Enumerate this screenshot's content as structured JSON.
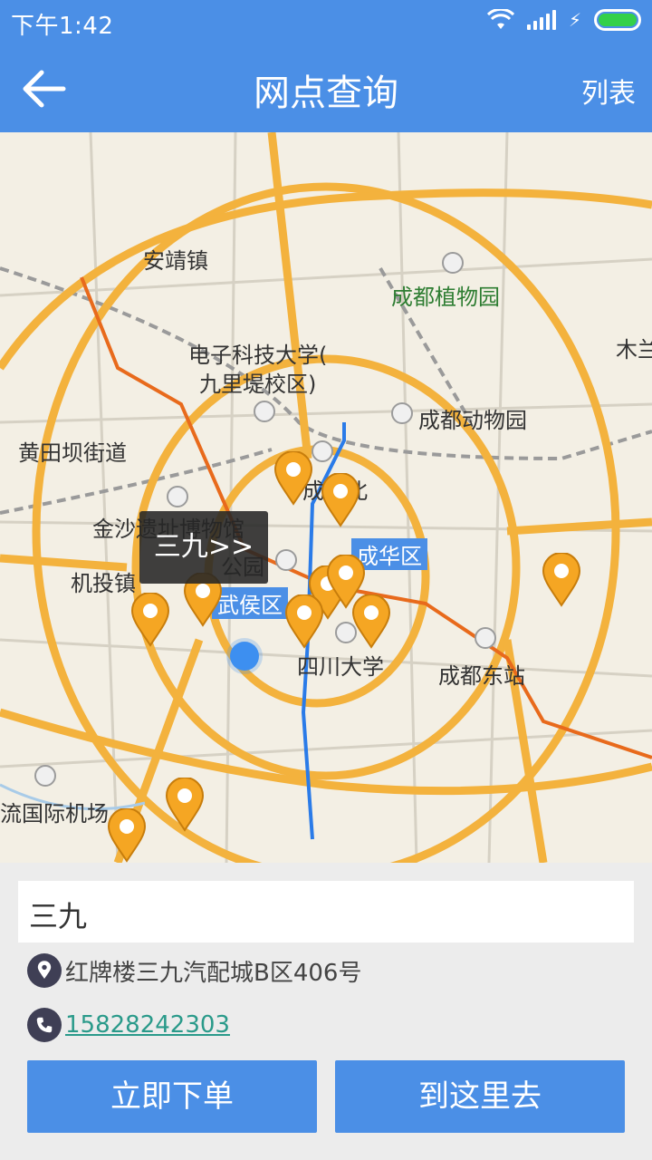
{
  "status": {
    "time": "下午1:42"
  },
  "appbar": {
    "title": "网点查询",
    "list_label": "列表"
  },
  "map": {
    "labels": {
      "anjing": "安靖镇",
      "botanic": "成都植物园",
      "uestc1": "电子科技大学(",
      "uestc2": "九里堤校区)",
      "zoo": "成都动物园",
      "mu": "木兰",
      "huangtianba": "黄田坝街道",
      "jinsha": "金沙遗址博物馆",
      "chenghua": "成华区",
      "jitou": "机投镇",
      "wuhou": "武侯区",
      "chengdu": "成都北",
      "scu": "四川大学",
      "east": "成都东站",
      "park": "公园",
      "airport": "流国际机场"
    },
    "tooltip": "三九>>",
    "pin_color": "#f5a623"
  },
  "store": {
    "name": "三九",
    "address": "红牌楼三九汽配城B区406号",
    "phone": "15828242303"
  },
  "actions": {
    "order_label": "立即下单",
    "go_label": "到这里去"
  },
  "colors": {
    "brand": "#4b8fe6",
    "link": "#2a9a8a"
  }
}
